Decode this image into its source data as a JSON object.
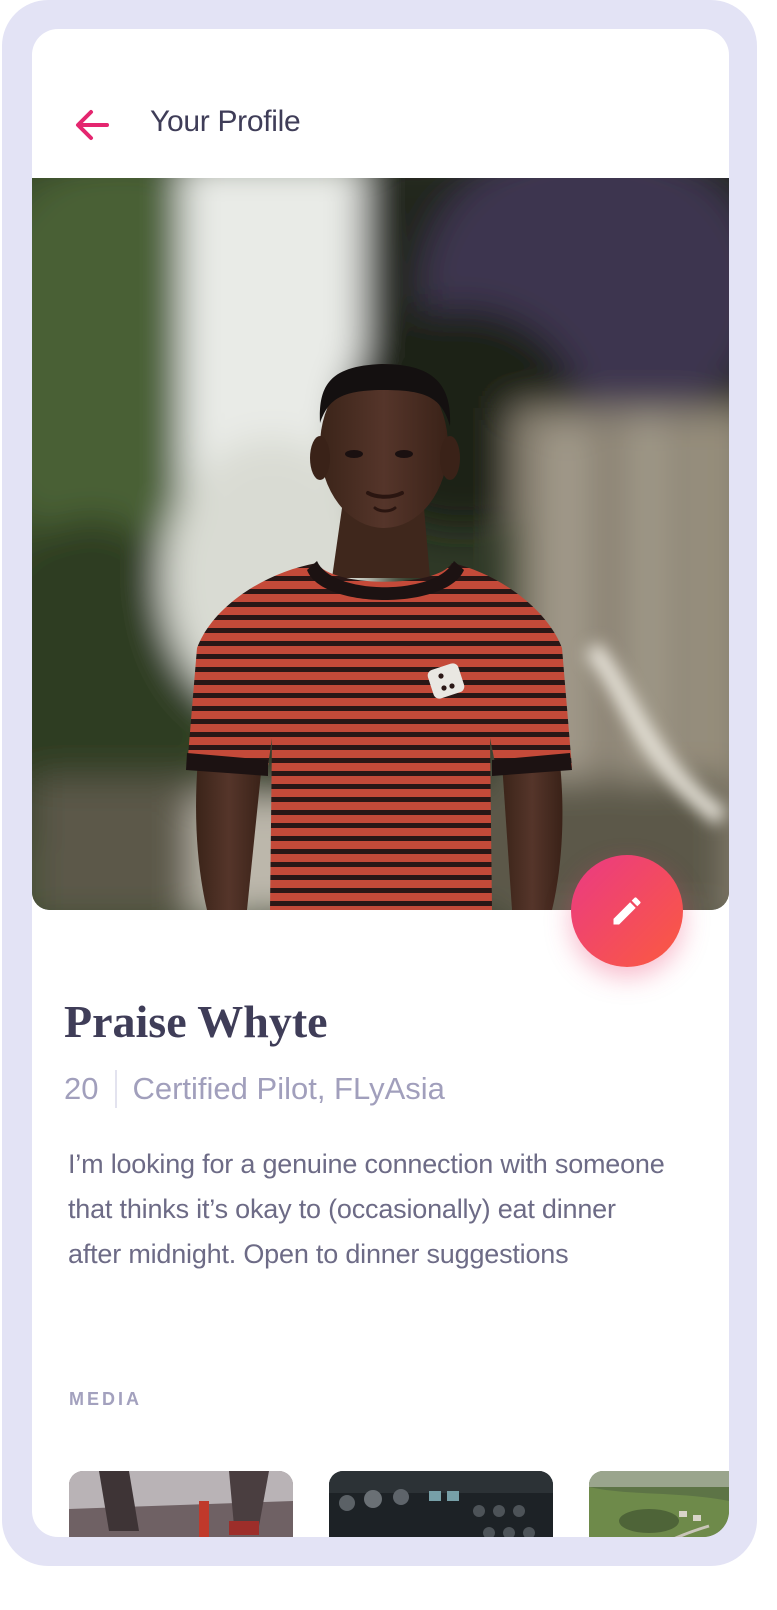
{
  "header": {
    "title": "Your Profile",
    "back_icon": "arrow-left-icon",
    "accent_color": "#e4266f"
  },
  "profile": {
    "name": "Praise Whyte",
    "age": "20",
    "occupation": "Certified Pilot, FLyAsia",
    "bio": "I’m looking for a genuine connection with someone that thinks it’s okay to (occasionally) eat dinner after midnight. Open to dinner suggestions",
    "edit_icon": "pencil-icon"
  },
  "media": {
    "label": "MEDIA",
    "items": [
      "airplane-wing-photo",
      "cockpit-panel-photo",
      "aerial-landscape-photo"
    ]
  },
  "colors": {
    "frame": "#e3e3f5",
    "title_text": "#3f3d58",
    "muted_text": "#a19fbc",
    "fab_gradient_start": "#ea3a84",
    "fab_gradient_end": "#fb5a3f"
  }
}
